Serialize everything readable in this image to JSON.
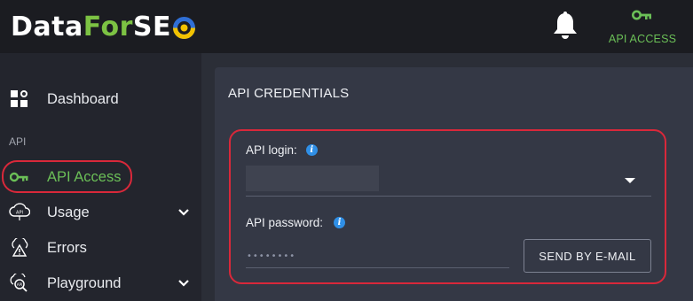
{
  "brand": {
    "logo_part1": "Data",
    "logo_part2": "For",
    "logo_part3": "SE",
    "colors": {
      "white": "#ffffff",
      "green": "#7cc243",
      "yellow": "#f2c200",
      "blue": "#2f6fd6"
    }
  },
  "header": {
    "notifications_icon": "bell-icon",
    "api_access_icon": "key-icon",
    "api_access_label": "API ACCESS"
  },
  "sidebar": {
    "section_label": "API",
    "items": [
      {
        "label": "Dashboard",
        "icon": "dashboard-icon"
      },
      {
        "label": "API Access",
        "icon": "key-icon",
        "active": true
      },
      {
        "label": "Usage",
        "icon": "cloud-api-icon",
        "expandable": true
      },
      {
        "label": "Errors",
        "icon": "warning-triangle-icon"
      },
      {
        "label": "Playground",
        "icon": "search-api-icon",
        "expandable": true
      }
    ]
  },
  "main": {
    "card_title": "API CREDENTIALS",
    "login_label": "API login:",
    "password_label": "API password:",
    "password_mask": "••••••••",
    "send_button_label": "SEND BY E-MAIL"
  },
  "colors": {
    "accent_green": "#6bbf57",
    "highlight_red": "#d9283a",
    "info_blue": "#2f8fe6"
  }
}
